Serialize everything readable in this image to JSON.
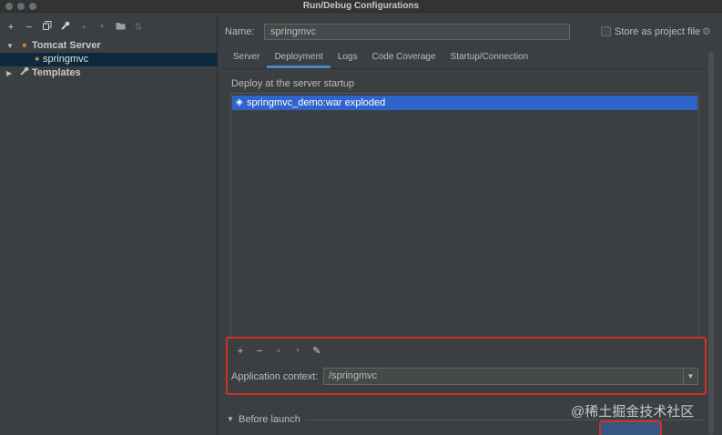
{
  "window": {
    "title": "Run/Debug Configurations"
  },
  "left_toolbar": {
    "buttons": [
      {
        "name": "add-configuration-button",
        "glyph": "+",
        "enabled": true
      },
      {
        "name": "remove-configuration-button",
        "glyph": "−",
        "enabled": true
      },
      {
        "name": "copy-configuration-button",
        "glyph": "⧉",
        "enabled": true
      },
      {
        "name": "edit-defaults-button",
        "glyph": "🔧",
        "enabled": true
      },
      {
        "name": "move-up-button",
        "glyph": "▲",
        "enabled": false
      },
      {
        "name": "move-down-button",
        "glyph": "▼",
        "enabled": false
      },
      {
        "name": "folder-button",
        "glyph": "📁",
        "enabled": true
      },
      {
        "name": "sort-button",
        "glyph": "⇅",
        "enabled": false
      }
    ]
  },
  "tree": {
    "tomcat_server": "Tomcat Server",
    "springmvc": "springmvc",
    "templates": "Templates"
  },
  "name_field": {
    "label": "Name:",
    "value": "springmvc"
  },
  "store_as_project_file": {
    "label": "Store as project file",
    "checked": false
  },
  "tabs": [
    "Server",
    "Deployment",
    "Logs",
    "Code Coverage",
    "Startup/Connection"
  ],
  "active_tab": "Deployment",
  "deployment": {
    "heading": "Deploy at the server startup",
    "items": [
      "springmvc_demo:war exploded"
    ]
  },
  "deploy_toolbar": {
    "add": "+",
    "remove": "−",
    "up": "▲",
    "down": "▼",
    "edit": "✎"
  },
  "application_context": {
    "label": "Application context:",
    "value": "/springmvc"
  },
  "before_launch": {
    "label": "Before launch"
  },
  "watermark": "@稀土掘金技术社区",
  "colors": {
    "selection": "#2f65ca",
    "highlight_box": "#d0302a",
    "accent": "#4a88c7"
  }
}
